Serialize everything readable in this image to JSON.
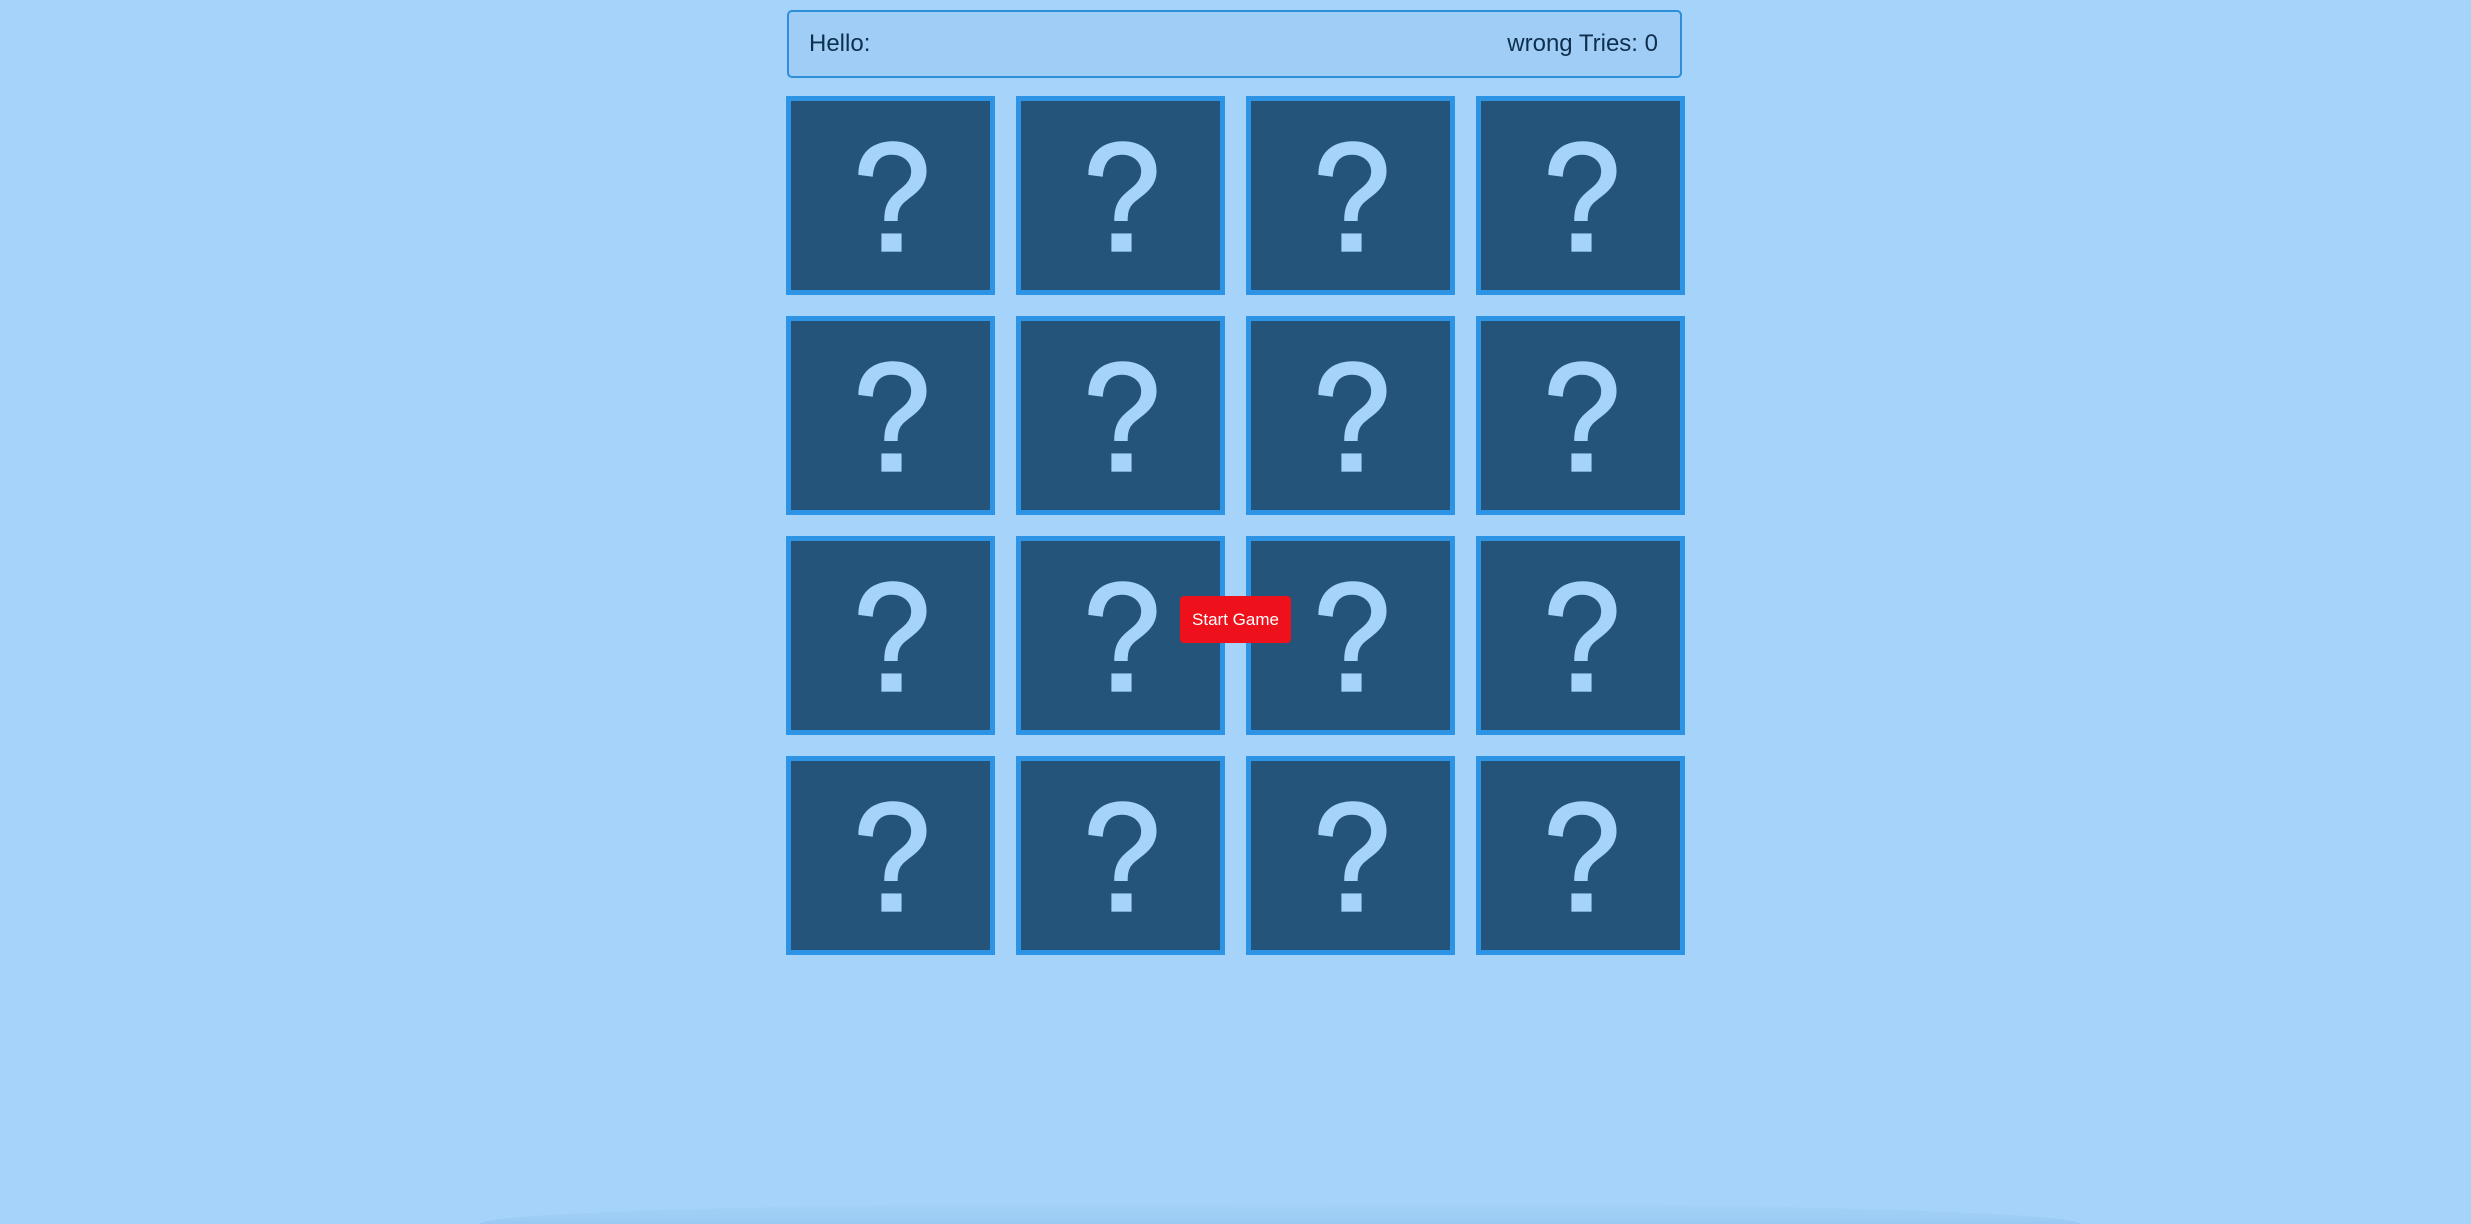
{
  "header": {
    "greeting": "Hello:",
    "tries_label": "wrong Tries: 0"
  },
  "board": {
    "rows": 4,
    "columns": 4,
    "cards": [
      {
        "symbol": "question-mark-icon"
      },
      {
        "symbol": "question-mark-icon"
      },
      {
        "symbol": "question-mark-icon"
      },
      {
        "symbol": "question-mark-icon"
      },
      {
        "symbol": "question-mark-icon"
      },
      {
        "symbol": "question-mark-icon"
      },
      {
        "symbol": "question-mark-icon"
      },
      {
        "symbol": "question-mark-icon"
      },
      {
        "symbol": "question-mark-icon"
      },
      {
        "symbol": "question-mark-icon"
      },
      {
        "symbol": "question-mark-icon"
      },
      {
        "symbol": "question-mark-icon"
      },
      {
        "symbol": "question-mark-icon"
      },
      {
        "symbol": "question-mark-icon"
      },
      {
        "symbol": "question-mark-icon"
      },
      {
        "symbol": "question-mark-icon"
      }
    ]
  },
  "start_button": {
    "label": "Start Game"
  },
  "colors": {
    "background": "#a5d3f9",
    "card_face": "#245479",
    "card_border": "#2d93e4",
    "question_mark": "#a5d3f9",
    "button": "#ee111b",
    "text": "#0f2f4f"
  }
}
